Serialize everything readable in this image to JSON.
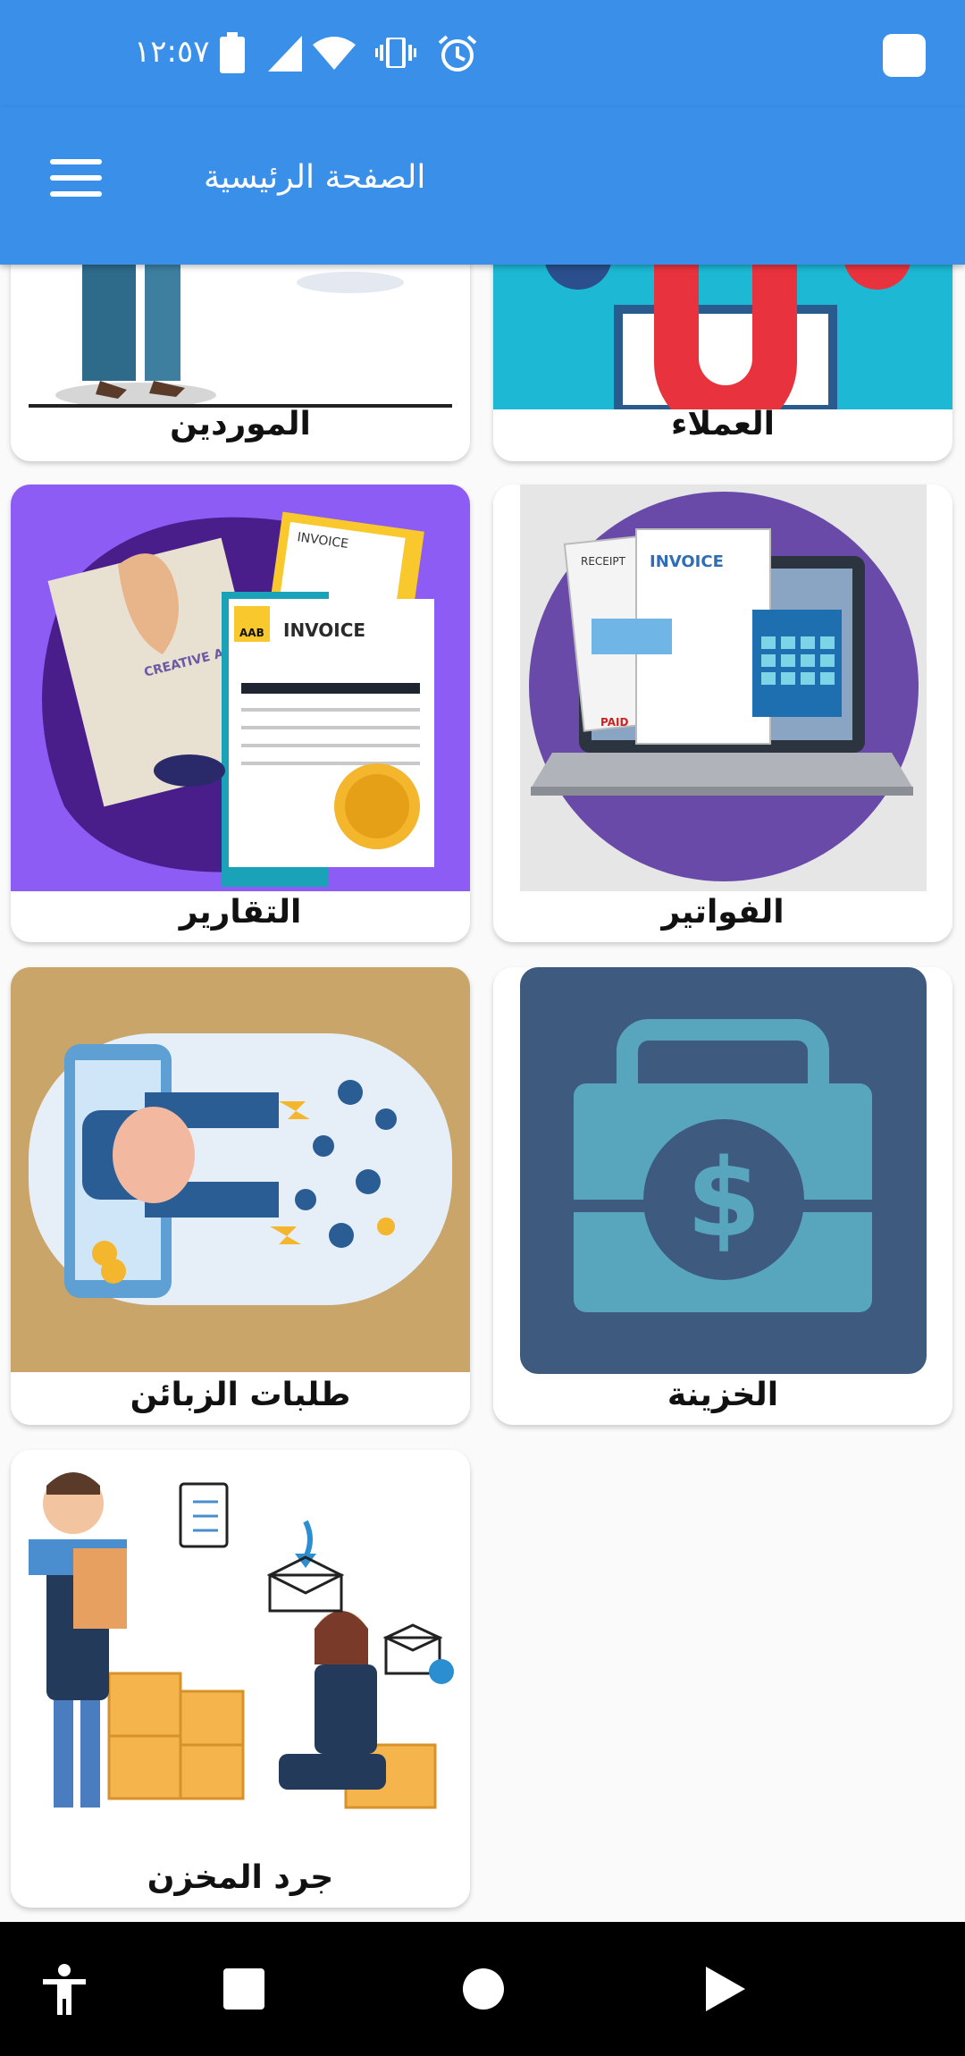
{
  "status_bar": {
    "time": "١٢:٥٧",
    "icons": [
      "alarm-icon",
      "vibrate-icon",
      "wifi-icon",
      "signal-icon",
      "battery-icon",
      "notification-icon"
    ]
  },
  "app_bar": {
    "title": "الصفحة الرئيسية",
    "menu_icon": "hamburger-menu-icon"
  },
  "cards": [
    {
      "label": "العملاء"
    },
    {
      "label": "الموردين"
    },
    {
      "label": "الفواتير",
      "image_text": [
        "INVOICE",
        "RECEIPT",
        "PAID"
      ]
    },
    {
      "label": "التقارير",
      "image_text": [
        "INVOICE",
        "INVOICE",
        "CREATIVE AGENCY",
        "AAB"
      ]
    },
    {
      "label": "الخزينة"
    },
    {
      "label": "طلبات الزبائن"
    },
    {
      "label": "جرد المخزن"
    }
  ],
  "nav_bar": {
    "icons": [
      "accessibility-icon",
      "recents-icon",
      "home-icon",
      "back-icon"
    ]
  },
  "colors": {
    "primary": "#3a8fe8",
    "nav_background": "#000000",
    "card_background": "#ffffff"
  }
}
